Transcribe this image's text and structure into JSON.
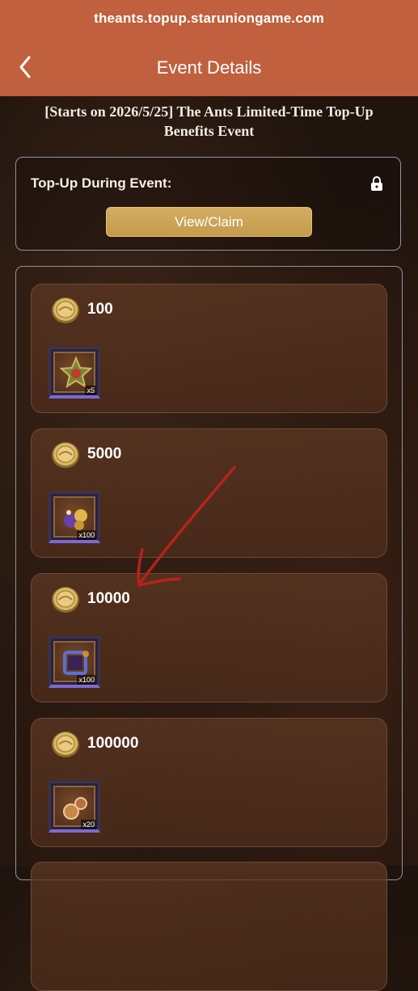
{
  "browser": {
    "url": "theants.topup.staruniongame.com"
  },
  "header": {
    "title": "Event Details",
    "back_icon": "chevron-left-icon"
  },
  "event": {
    "title": "[Starts on 2026/5/25] The Ants Limited-Time Top-Up Benefits Event"
  },
  "topup": {
    "label": "Top-Up During Event:",
    "lock_icon": "lock-icon",
    "button_label": "View/Claim"
  },
  "tiers": [
    {
      "amount": "100",
      "reward_icon": "badge-item-icon",
      "quantity": "x5"
    },
    {
      "amount": "5000",
      "reward_icon": "gem-bundle-icon",
      "quantity": "x100"
    },
    {
      "amount": "10000",
      "reward_icon": "puzzle-fragment-icon",
      "quantity": "x100"
    },
    {
      "amount": "100000",
      "reward_icon": "orb-item-icon",
      "quantity": "x20"
    }
  ],
  "colors": {
    "header_bg": "#c0603e",
    "button_gold": "#c9a052",
    "annotation_red": "#b8221c"
  }
}
